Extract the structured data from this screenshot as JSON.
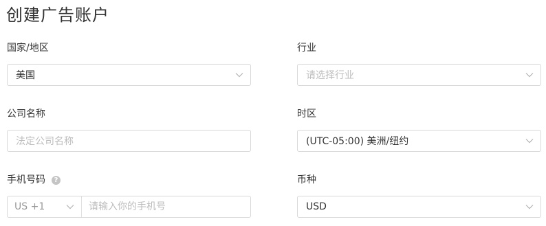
{
  "page": {
    "title": "创建广告账户"
  },
  "form": {
    "country": {
      "label": "国家/地区",
      "value": "美国"
    },
    "industry": {
      "label": "行业",
      "placeholder": "请选择行业"
    },
    "company": {
      "label": "公司名称",
      "placeholder": "法定公司名称"
    },
    "timezone": {
      "label": "时区",
      "value": "(UTC-05:00) 美洲/纽约"
    },
    "phone": {
      "label": "手机号码",
      "help_icon": "question-circle-icon",
      "help_glyph": "?",
      "country_code": "US +1",
      "placeholder": "请输入你的手机号"
    },
    "currency": {
      "label": "币种",
      "value": "USD"
    }
  },
  "colors": {
    "border": "#d9d9d9",
    "placeholder": "#bdbdbd",
    "text": "#333333",
    "chevron": "#b3b3b3"
  },
  "icons": {
    "dropdown": "chevron-down-icon"
  }
}
